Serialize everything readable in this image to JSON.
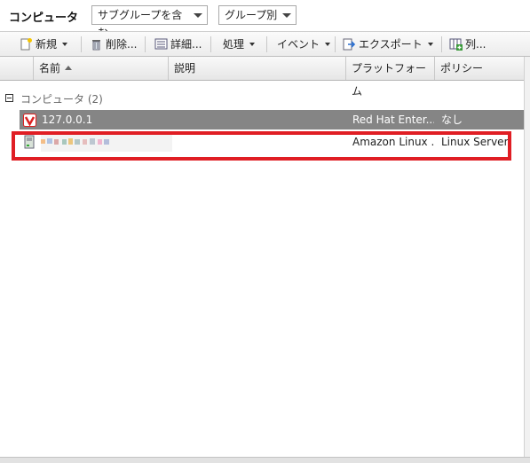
{
  "panel": {
    "title": "コンピュータ",
    "subgroup_filter": "サブグループを含む",
    "group_by": "グループ別"
  },
  "toolbar": {
    "new_label": "新規",
    "delete_label": "削除...",
    "details_label": "詳細...",
    "actions_label": "処理",
    "events_label": "イベント",
    "export_label": "エクスポート",
    "columns_label": "列..."
  },
  "table": {
    "columns": [
      "名前",
      "説明",
      "プラットフォーム",
      "ポリシー"
    ],
    "group": {
      "label": "コンピュータ (2)"
    },
    "rows": [
      {
        "name": "127.0.0.1",
        "description": "",
        "platform": "Red Hat Enter...",
        "policy": "なし",
        "selected": true
      },
      {
        "name": "",
        "description": "",
        "platform": "Amazon Linux ...",
        "policy": "Linux Server",
        "selected": false
      }
    ]
  },
  "colors": {
    "selected_row": "#858585",
    "highlight_box": "#e01e24"
  }
}
